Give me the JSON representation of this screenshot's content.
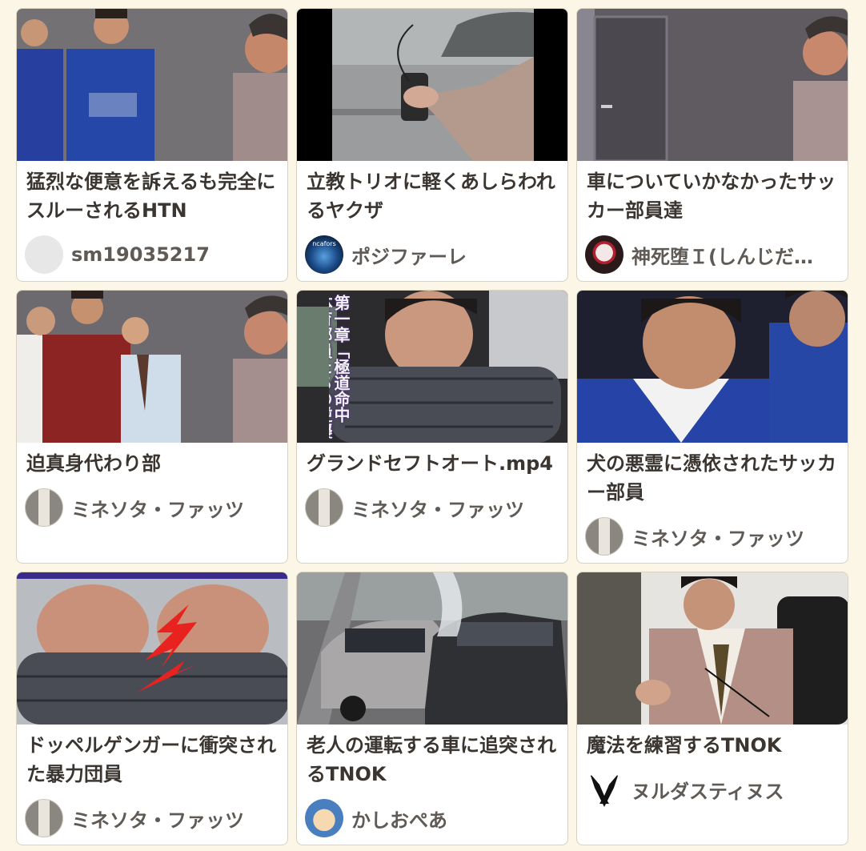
{
  "cards": [
    {
      "title": "猛烈な便意を訴えるも完全にスルーされるHTN",
      "author": "sm19035217",
      "avatar_icon": "placeholder-avatar-icon"
    },
    {
      "title": "立教トリオに軽くあしらわれるヤクザ",
      "author": "ポジファーレ",
      "avatar_icon": "user-avatar-icon"
    },
    {
      "title": "車についていかなかったサッカー部員達",
      "author": "神死堕Ｉ(しんじだ…",
      "avatar_icon": "user-avatar-icon"
    },
    {
      "title": "迫真身代わり部",
      "author": "ミネソタ・ファッツ",
      "avatar_icon": "user-avatar-icon"
    },
    {
      "title": "グランドセフトオート.mp4",
      "author": "ミネソタ・ファッツ",
      "avatar_icon": "user-avatar-icon"
    },
    {
      "title": "犬の悪霊に憑依されたサッカー部員",
      "author": "ミネソタ・ファッツ",
      "avatar_icon": "user-avatar-icon"
    },
    {
      "title": "ドッペルゲンガーに衝突された暴力団員",
      "author": "ミネソタ・ファッツ",
      "avatar_icon": "user-avatar-icon"
    },
    {
      "title": "老人の運転する車に追突されるTNOK",
      "author": "かしおぺあ",
      "avatar_icon": "user-avatar-icon"
    },
    {
      "title": "魔法を練習するTNOK",
      "author": "ヌルダスティヌス",
      "avatar_icon": "bird-logo-icon"
    }
  ],
  "thumbnail_texts": {
    "card5_overlay": "第一章「極道命中 体育部員たちの逆襲",
    "card3_logo": "ncafors"
  }
}
